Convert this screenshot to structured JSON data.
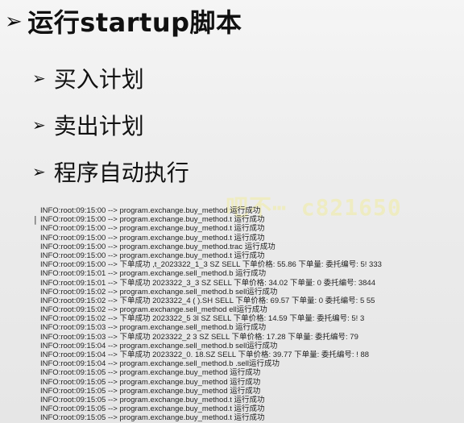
{
  "slide": {
    "title": "运行startup脚本",
    "title_marker": "➢",
    "bullet_marker": "➢",
    "bullets": [
      "买入计划",
      "卖出计划",
      "程序自动执行"
    ]
  },
  "watermark": "吧不⋯ c821650",
  "log_lines": [
    "INFO:root:09:15:00 --> program.exchange.buy_method                    运行成功",
    "INFO:root:09:15:00 --> program.exchange.buy_method.t                  运行成功",
    "INFO:root:09:15:00 --> program.exchange.buy_method.t                  运行成功",
    "INFO:root:09:15:00 --> program.exchange.buy_method.t                  运行成功",
    "INFO:root:09:15:00 --> program.exchange.buy_method.trac               运行成功",
    "INFO:root:09:15:00 --> program.exchange.buy_method.t                  运行成功",
    "INFO:root:09:15:00 --> 下单成功                    ,t_2023322_1_3          SZ SELL 下单价格:  55.86 下单量:        委托编号: 5!        333",
    "INFO:root:09:15:01 --> program.exchange.sell_method.b            运行成功",
    "INFO:root:09:15:01 --> 下单成功                    2023322_3_3           SZ SELL 下单价格:  34.02 下单量:      0 委托编号:          3844",
    "INFO:root:09:15:02 --> program.exchange.sell_method.b         sell运行成功",
    "INFO:root:09:15:02 --> 下单成功                    2023322_4 (      ).SH SELL 下单价格:  69.57 下单量:      0 委托编号:  5       55",
    "INFO:root:09:15:02 --> program.exchange.sell_method           ell运行成功",
    "INFO:root:09:15:02 --> 下单成功                  2023322_5 3l        SZ SELL 下单价格:  14.59 下单量:        委托编号:  5!          3",
    "INFO:root:09:15:03 --> program.exchange.sell_method.b        运行成功",
    "INFO:root:09:15:03 --> 下单成功                  2023322_2 3          SZ SELL 下单价格:  17.28 下单量:        委托编号:           79",
    "INFO:root:09:15:04 --> program.exchange.sell_method.b        sell运行成功",
    "INFO:root:09:15:04 --> 下单成功                  2023322_0.           18.SZ SELL 下单价格:  39.77 下单量:         委托编号:  !        88",
    "INFO:root:09:15:04 --> program.exchange.sell_method.b        .sell运行成功",
    "INFO:root:09:15:05 --> program.exchange.buy_method                    运行成功",
    "INFO:root:09:15:05 --> program.exchange.buy_method                    运行成功",
    "INFO:root:09:15:05 --> program.exchange.buy_method                    运行成功",
    "INFO:root:09:15:05 --> program.exchange.buy_method.t                  运行成功",
    "INFO:root:09:15:05 --> program.exchange.buy_method.t                  运行成功",
    "INFO:root:09:15:05 --> program.exchange.buy_method.t                  运行成功"
  ]
}
